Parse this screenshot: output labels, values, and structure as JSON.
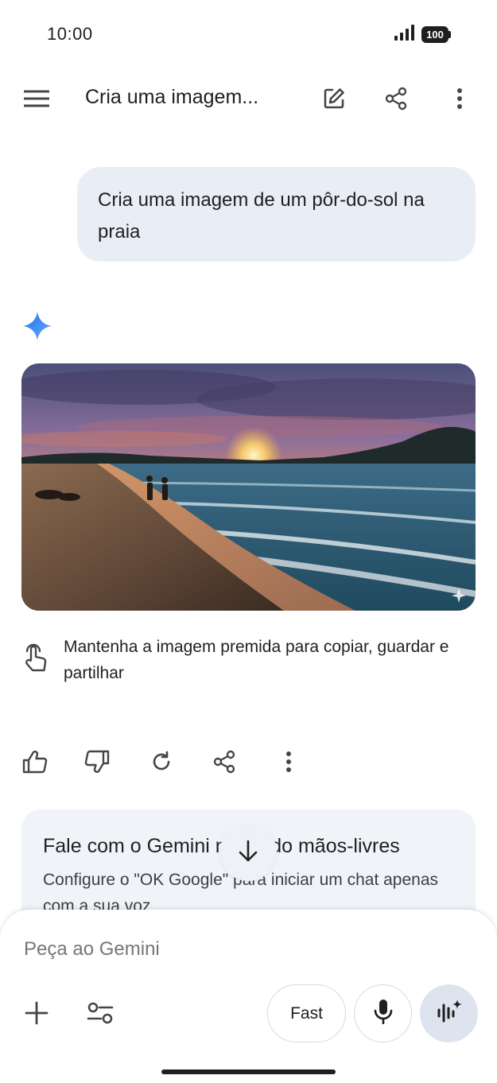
{
  "status_bar": {
    "time": "10:00",
    "battery": "100",
    "icons": [
      "signal-icon",
      "battery-icon"
    ]
  },
  "top_bar": {
    "title": "Cria uma imagem...",
    "icons": [
      "menu-icon",
      "edit-icon",
      "share-icon",
      "more-vert-icon"
    ]
  },
  "conversation": {
    "user_message": "Cria uma imagem de um pôr-do-sol na praia",
    "response_icon": "gemini-spark-icon",
    "image_icon": "generated-image",
    "hint_icon": "touch-hold-icon",
    "hint_text": "Mantenha a imagem premida para copiar, guardar e partilhar",
    "actions": [
      "thumb-up-icon",
      "thumb-down-icon",
      "regenerate-icon",
      "share-icon",
      "more-vert-icon"
    ]
  },
  "promo_card": {
    "title": "Fale com o Gemini no modo mãos-livres",
    "body": "Configure o \"OK Google\" para iniciar um chat apenas com a sua voz"
  },
  "scroll_down_icon": "arrow-down-icon",
  "input_bar": {
    "placeholder": "Peça ao Gemini",
    "mode_label": "Fast",
    "icons": [
      "plus-icon",
      "tools-icon",
      "mic-icon",
      "gemini-live-icon"
    ]
  },
  "colors": {
    "bubble": "#e9eef6",
    "card": "#f0f4f9",
    "live_button": "#dde3ef",
    "accent": "#4285f4"
  }
}
